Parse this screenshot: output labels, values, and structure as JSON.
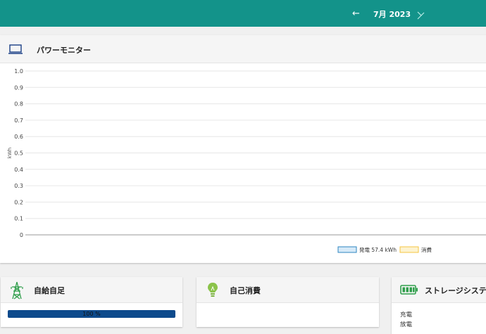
{
  "header": {
    "month_label": "7月 2023",
    "prev_icon": "arrow-left-icon",
    "next_icon": "arrow-right-icon",
    "bar_color": "#13938a"
  },
  "monitor": {
    "title": "パワーモニター",
    "icon": "laptop-icon",
    "chart_data": {
      "type": "line",
      "ylabel": "kWh",
      "ylim": [
        0,
        1.0
      ],
      "yticks": [
        "0",
        "0.1",
        "0.2",
        "0.3",
        "0.4",
        "0.5",
        "0.6",
        "0.7",
        "0.8",
        "0.9",
        "1.0"
      ],
      "grid": true,
      "legend_position": "bottom-right",
      "series": [
        {
          "name": "発電 57.4 kWh",
          "values": [],
          "color": "#2e86c1",
          "fill": "#d6eaf8"
        },
        {
          "name": "消費",
          "values": [],
          "color": "#f5c542",
          "fill": "#fdf3d0"
        }
      ]
    }
  },
  "self_sufficiency": {
    "title": "自給自足",
    "icon": "power-tower-icon",
    "progress_value": 100,
    "progress_label": "100 %",
    "accent": "#0d4a8c"
  },
  "self_consumption": {
    "title": "自己消費",
    "icon": "lightbulb-icon"
  },
  "storage": {
    "title": "ストレージシステム",
    "icon": "battery-icon",
    "charge_label": "充電",
    "discharge_label": "放電"
  }
}
